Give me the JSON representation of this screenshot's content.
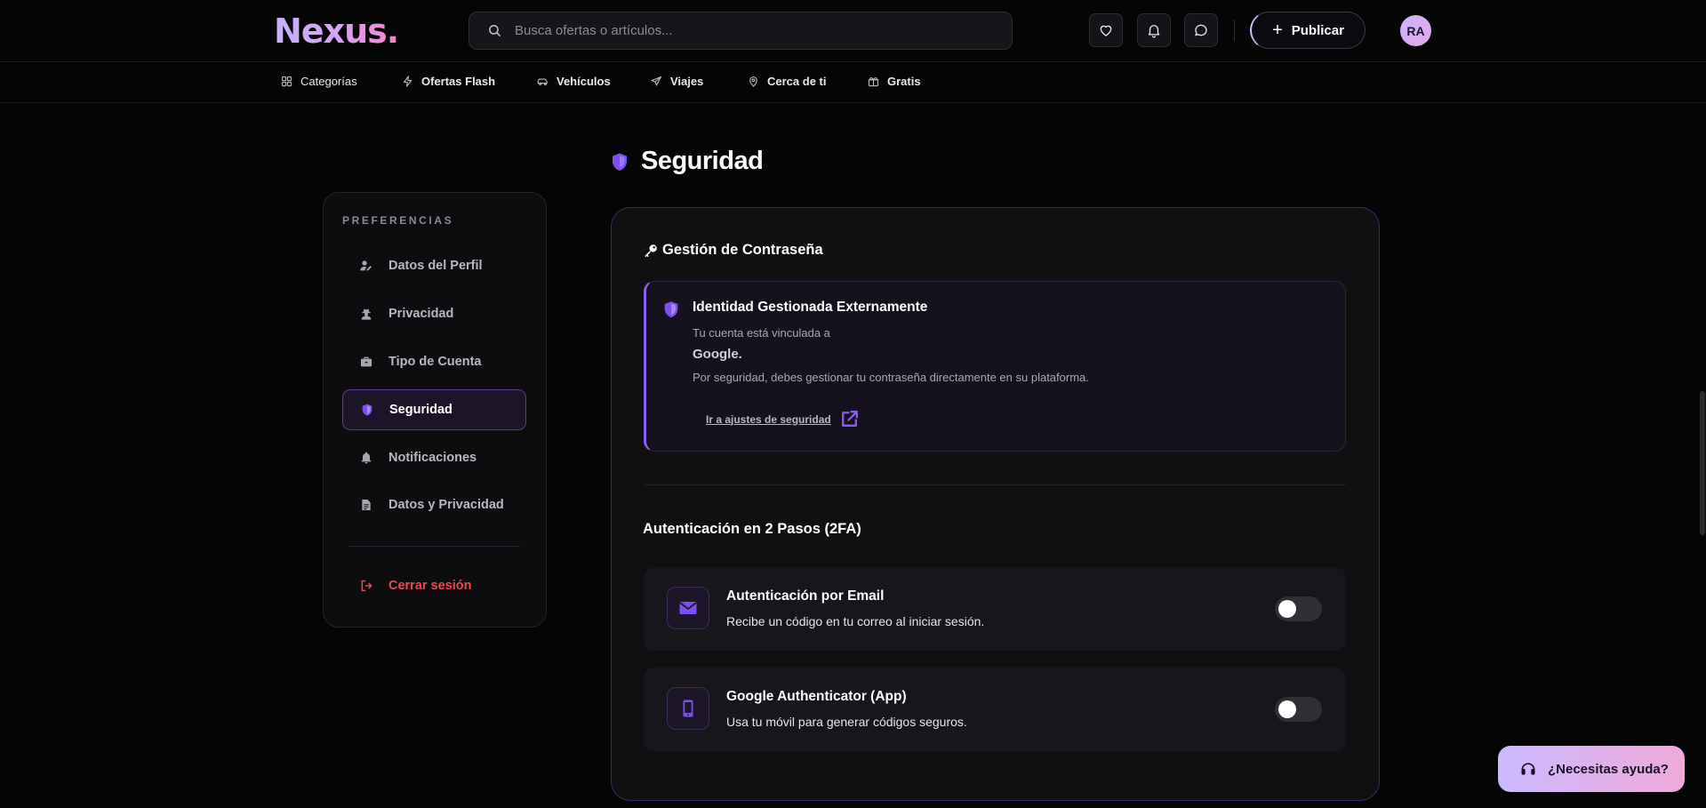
{
  "header": {
    "logo": "Nexus.",
    "search_placeholder": "Busca ofertas o artículos...",
    "favorites_icon": "heart-icon",
    "notifications_icon": "bell-icon",
    "messages_icon": "chat-icon",
    "publish_label": "Publicar",
    "avatar_initials": "RA"
  },
  "catnav": {
    "items": [
      {
        "label": "Categorías",
        "icon": "grid-icon"
      },
      {
        "label": "Ofertas Flash",
        "icon": "bolt-icon"
      },
      {
        "label": "Vehículos",
        "icon": "car-icon"
      },
      {
        "label": "Viajes",
        "icon": "plane-icon"
      },
      {
        "label": "Cerca de ti",
        "icon": "location-pin-icon"
      },
      {
        "label": "Gratis",
        "icon": "gift-icon"
      }
    ]
  },
  "page": {
    "title": "Seguridad",
    "title_icon": "shield-icon"
  },
  "sidebar": {
    "heading": "PREFERENCIAS",
    "items": [
      {
        "label": "Datos del Perfil",
        "icon": "user-edit-icon",
        "active": false
      },
      {
        "label": "Privacidad",
        "icon": "user-secret-icon",
        "active": false
      },
      {
        "label": "Tipo de Cuenta",
        "icon": "briefcase-icon",
        "active": false
      },
      {
        "label": "Seguridad",
        "icon": "shield-icon",
        "active": true
      },
      {
        "label": "Notificaciones",
        "icon": "bell-icon",
        "active": false
      },
      {
        "label": "Datos y Privacidad",
        "icon": "document-icon",
        "active": false
      }
    ],
    "logout_label": "Cerrar sesión",
    "logout_icon": "logout-icon"
  },
  "password": {
    "title": "Gestión de Contraseña",
    "title_icon": "key-icon",
    "external": {
      "title": "Identidad Gestionada Externamente",
      "line1": "Tu cuenta está vinculada a",
      "provider": "Google.",
      "line2": "Por seguridad, debes gestionar tu contraseña directamente en su plataforma.",
      "link_label": "Ir a ajustes de seguridad",
      "link_icon": "external-link-icon"
    }
  },
  "twofa": {
    "title": "Autenticación en 2 Pasos (2FA)",
    "options": [
      {
        "title": "Autenticación por Email",
        "desc": "Recibe un código en tu correo al iniciar sesión.",
        "icon": "envelope-icon",
        "enabled": false
      },
      {
        "title": "Google Authenticator (App)",
        "desc": "Usa tu móvil para generar códigos seguros.",
        "icon": "mobile-icon",
        "enabled": false
      }
    ]
  },
  "help": {
    "label": "¿Necesitas ayuda?",
    "icon": "headset-icon"
  },
  "colors": {
    "accent": "#8b5cf6",
    "danger": "#ea4b52",
    "background": "#050505"
  }
}
